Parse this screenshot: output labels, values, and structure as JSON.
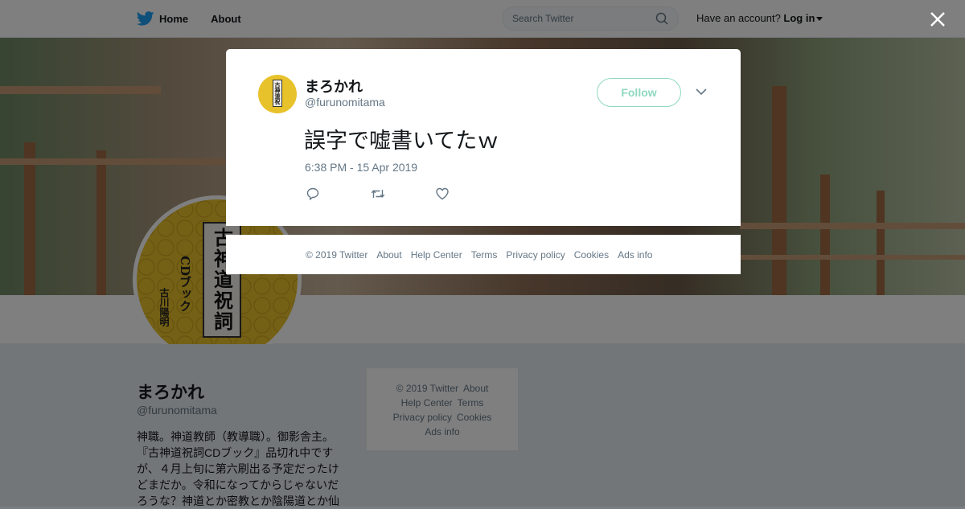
{
  "nav": {
    "home_label": "Home",
    "about_label": "About",
    "search_placeholder": "Search Twitter",
    "account_prompt": "Have an account?",
    "login_label": "Log in"
  },
  "profile": {
    "name": "まろかれ",
    "handle": "@furunomitama",
    "bio": "神職。神道教師（教導職）。御影舎主。『古神道祝詞CDブック』品切れ中ですが、４月上旬に第六刷出る予定だったけどまだか。令和になってからじゃないだろうな？神道とか密教とか陰陽道とか仙",
    "avatar_title": "古神道祝詞",
    "avatar_sub": "CDブック",
    "avatar_author": "古川陽明"
  },
  "side_footer": {
    "items": [
      "© 2019 Twitter",
      "About",
      "Help Center",
      "Terms",
      "Privacy policy",
      "Cookies",
      "Ads info"
    ]
  },
  "tweet": {
    "author_name": "まろかれ",
    "author_handle": "@furunomitama",
    "follow_label": "Follow",
    "text": "誤字で嘘書いてたｗ",
    "timestamp": "6:38 PM - 15 Apr 2019",
    "avatar_title": "古神道祝詞"
  },
  "footer": {
    "items": [
      "© 2019 Twitter",
      "About",
      "Help Center",
      "Terms",
      "Privacy policy",
      "Cookies",
      "Ads info"
    ]
  },
  "colors": {
    "twitter_blue": "#1da1f2",
    "follow_accent": "#8fd8bf",
    "avatar_gold": "#e8c22b"
  },
  "icons": [
    "twitter-bird-icon",
    "search-icon",
    "caret-down-icon",
    "close-icon",
    "chevron-down-icon",
    "reply-icon",
    "retweet-icon",
    "like-icon"
  ]
}
